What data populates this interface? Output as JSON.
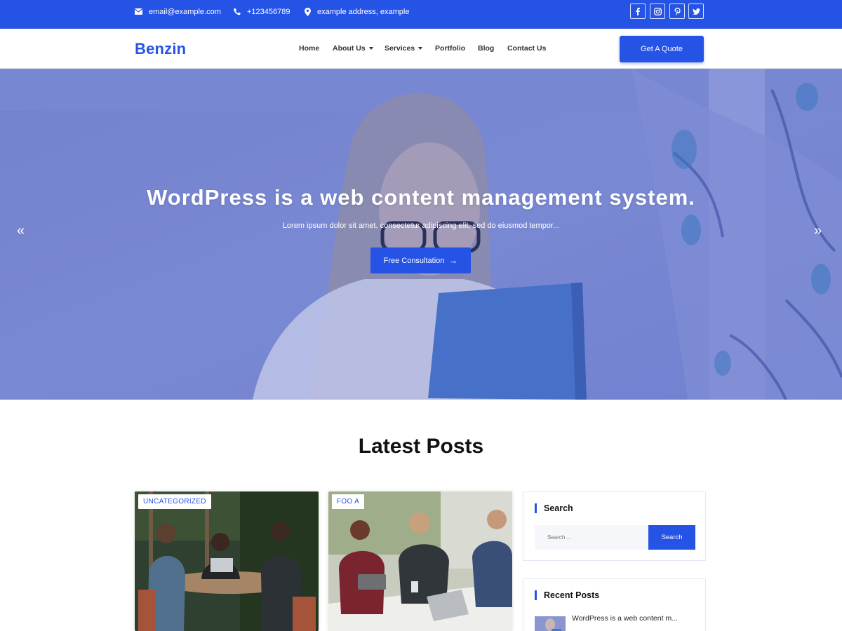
{
  "topbar": {
    "email": "email@example.com",
    "phone": "+123456789",
    "address": "example address, example",
    "social": [
      "facebook-icon",
      "instagram-icon",
      "pinterest-icon",
      "twitter-icon"
    ]
  },
  "header": {
    "logo": "Benzin",
    "nav": [
      {
        "label": "Home"
      },
      {
        "label": "About Us",
        "dropdown": true
      },
      {
        "label": "Services",
        "dropdown": true
      },
      {
        "label": "Portfolio"
      },
      {
        "label": "Blog"
      },
      {
        "label": "Contact Us"
      }
    ],
    "cta": "Get A Quote"
  },
  "hero": {
    "title": "WordPress is a web content management system.",
    "subtitle": "Lorem ipsum dolor sit amet, consectetur adipiscing elit, sed do eiusmod tempor...",
    "button": "Free Consultation",
    "button_arrow": "→",
    "prev": "«",
    "next": "»"
  },
  "latest": {
    "title": "Latest Posts",
    "posts": [
      {
        "category": "UNCATEGORIZED"
      },
      {
        "category": "FOO A"
      }
    ]
  },
  "sidebar": {
    "search": {
      "title": "Search",
      "placeholder": "Search ...",
      "button": "Search"
    },
    "recent": {
      "title": "Recent Posts",
      "items": [
        {
          "title": "WordPress is a web content m..."
        }
      ]
    }
  },
  "colors": {
    "primary": "#2553e6",
    "text": "#111111"
  }
}
